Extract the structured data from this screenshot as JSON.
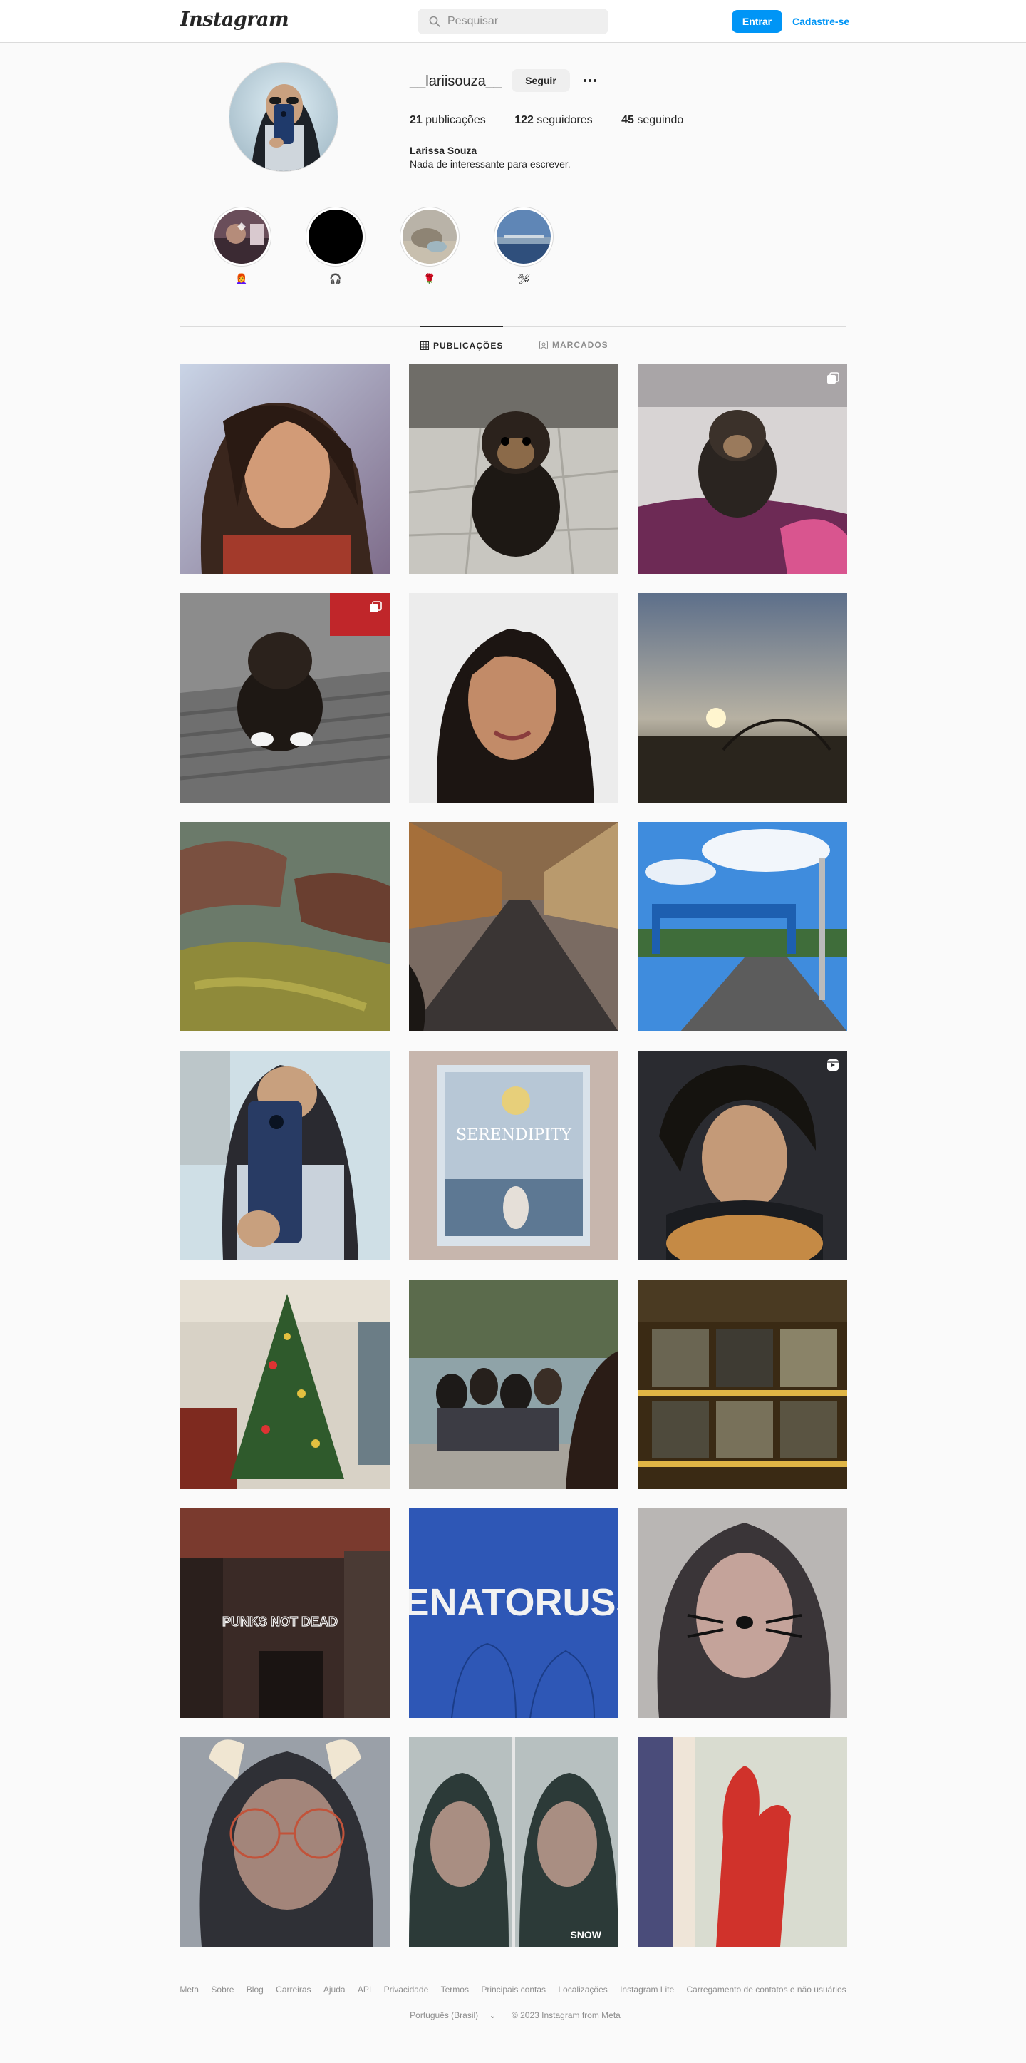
{
  "header": {
    "logo": "Instagram",
    "search_placeholder": "Pesquisar",
    "login_label": "Entrar",
    "signup_label": "Cadastre-se"
  },
  "profile": {
    "username": "__lariisouza__",
    "follow_label": "Seguir",
    "stats": [
      {
        "count": "21",
        "label": "publicações"
      },
      {
        "count": "122",
        "label": "seguidores"
      },
      {
        "count": "45",
        "label": "seguindo"
      }
    ],
    "full_name": "Larissa Souza",
    "bio": "Nada de interessante para escrever."
  },
  "highlights": [
    {
      "label": "👩‍🦰",
      "icon": "highlight-1"
    },
    {
      "label": "🎧",
      "icon": "highlight-2"
    },
    {
      "label": "🌹",
      "icon": "highlight-3"
    },
    {
      "label": "🛩",
      "icon": "highlight-4"
    }
  ],
  "tabs": [
    {
      "label": "PUBLICAÇÕES",
      "active": true
    },
    {
      "label": "MARCADOS",
      "active": false
    }
  ],
  "posts": [
    {
      "desc": "selfie",
      "badge": "none"
    },
    {
      "desc": "dog",
      "badge": "none"
    },
    {
      "desc": "dog-blanket",
      "badge": "carousel"
    },
    {
      "desc": "puppy",
      "badge": "carousel"
    },
    {
      "desc": "selfie-smile",
      "badge": "none"
    },
    {
      "desc": "sunset",
      "badge": "none"
    },
    {
      "desc": "rocks",
      "badge": "none"
    },
    {
      "desc": "street",
      "badge": "none"
    },
    {
      "desc": "road-sign",
      "badge": "none"
    },
    {
      "desc": "mirror-selfie",
      "badge": "none"
    },
    {
      "desc": "serendipity",
      "badge": "none"
    },
    {
      "desc": "guitar",
      "badge": "reel"
    },
    {
      "desc": "christmas-tree",
      "badge": "none"
    },
    {
      "desc": "group",
      "badge": "none"
    },
    {
      "desc": "records",
      "badge": "none"
    },
    {
      "desc": "neon",
      "badge": "none"
    },
    {
      "desc": "renato-russo",
      "badge": "none"
    },
    {
      "desc": "cat-filter",
      "badge": "none"
    },
    {
      "desc": "glasses-filter",
      "badge": "none"
    },
    {
      "desc": "snow-filter",
      "badge": "none"
    },
    {
      "desc": "red-hand",
      "badge": "none"
    }
  ],
  "post_texts": {
    "serendipity": "SERENDIPITY",
    "renato": "RENATORUSS",
    "neon": "PUNKS NOT DEAD",
    "snow": "SNOW"
  },
  "footer": {
    "links": [
      "Meta",
      "Sobre",
      "Blog",
      "Carreiras",
      "Ajuda",
      "API",
      "Privacidade",
      "Termos",
      "Principais contas",
      "Localizações",
      "Instagram Lite",
      "Carregamento de contatos e não usuários"
    ],
    "language": "Português (Brasil)",
    "copyright": "© 2023 Instagram from Meta"
  }
}
